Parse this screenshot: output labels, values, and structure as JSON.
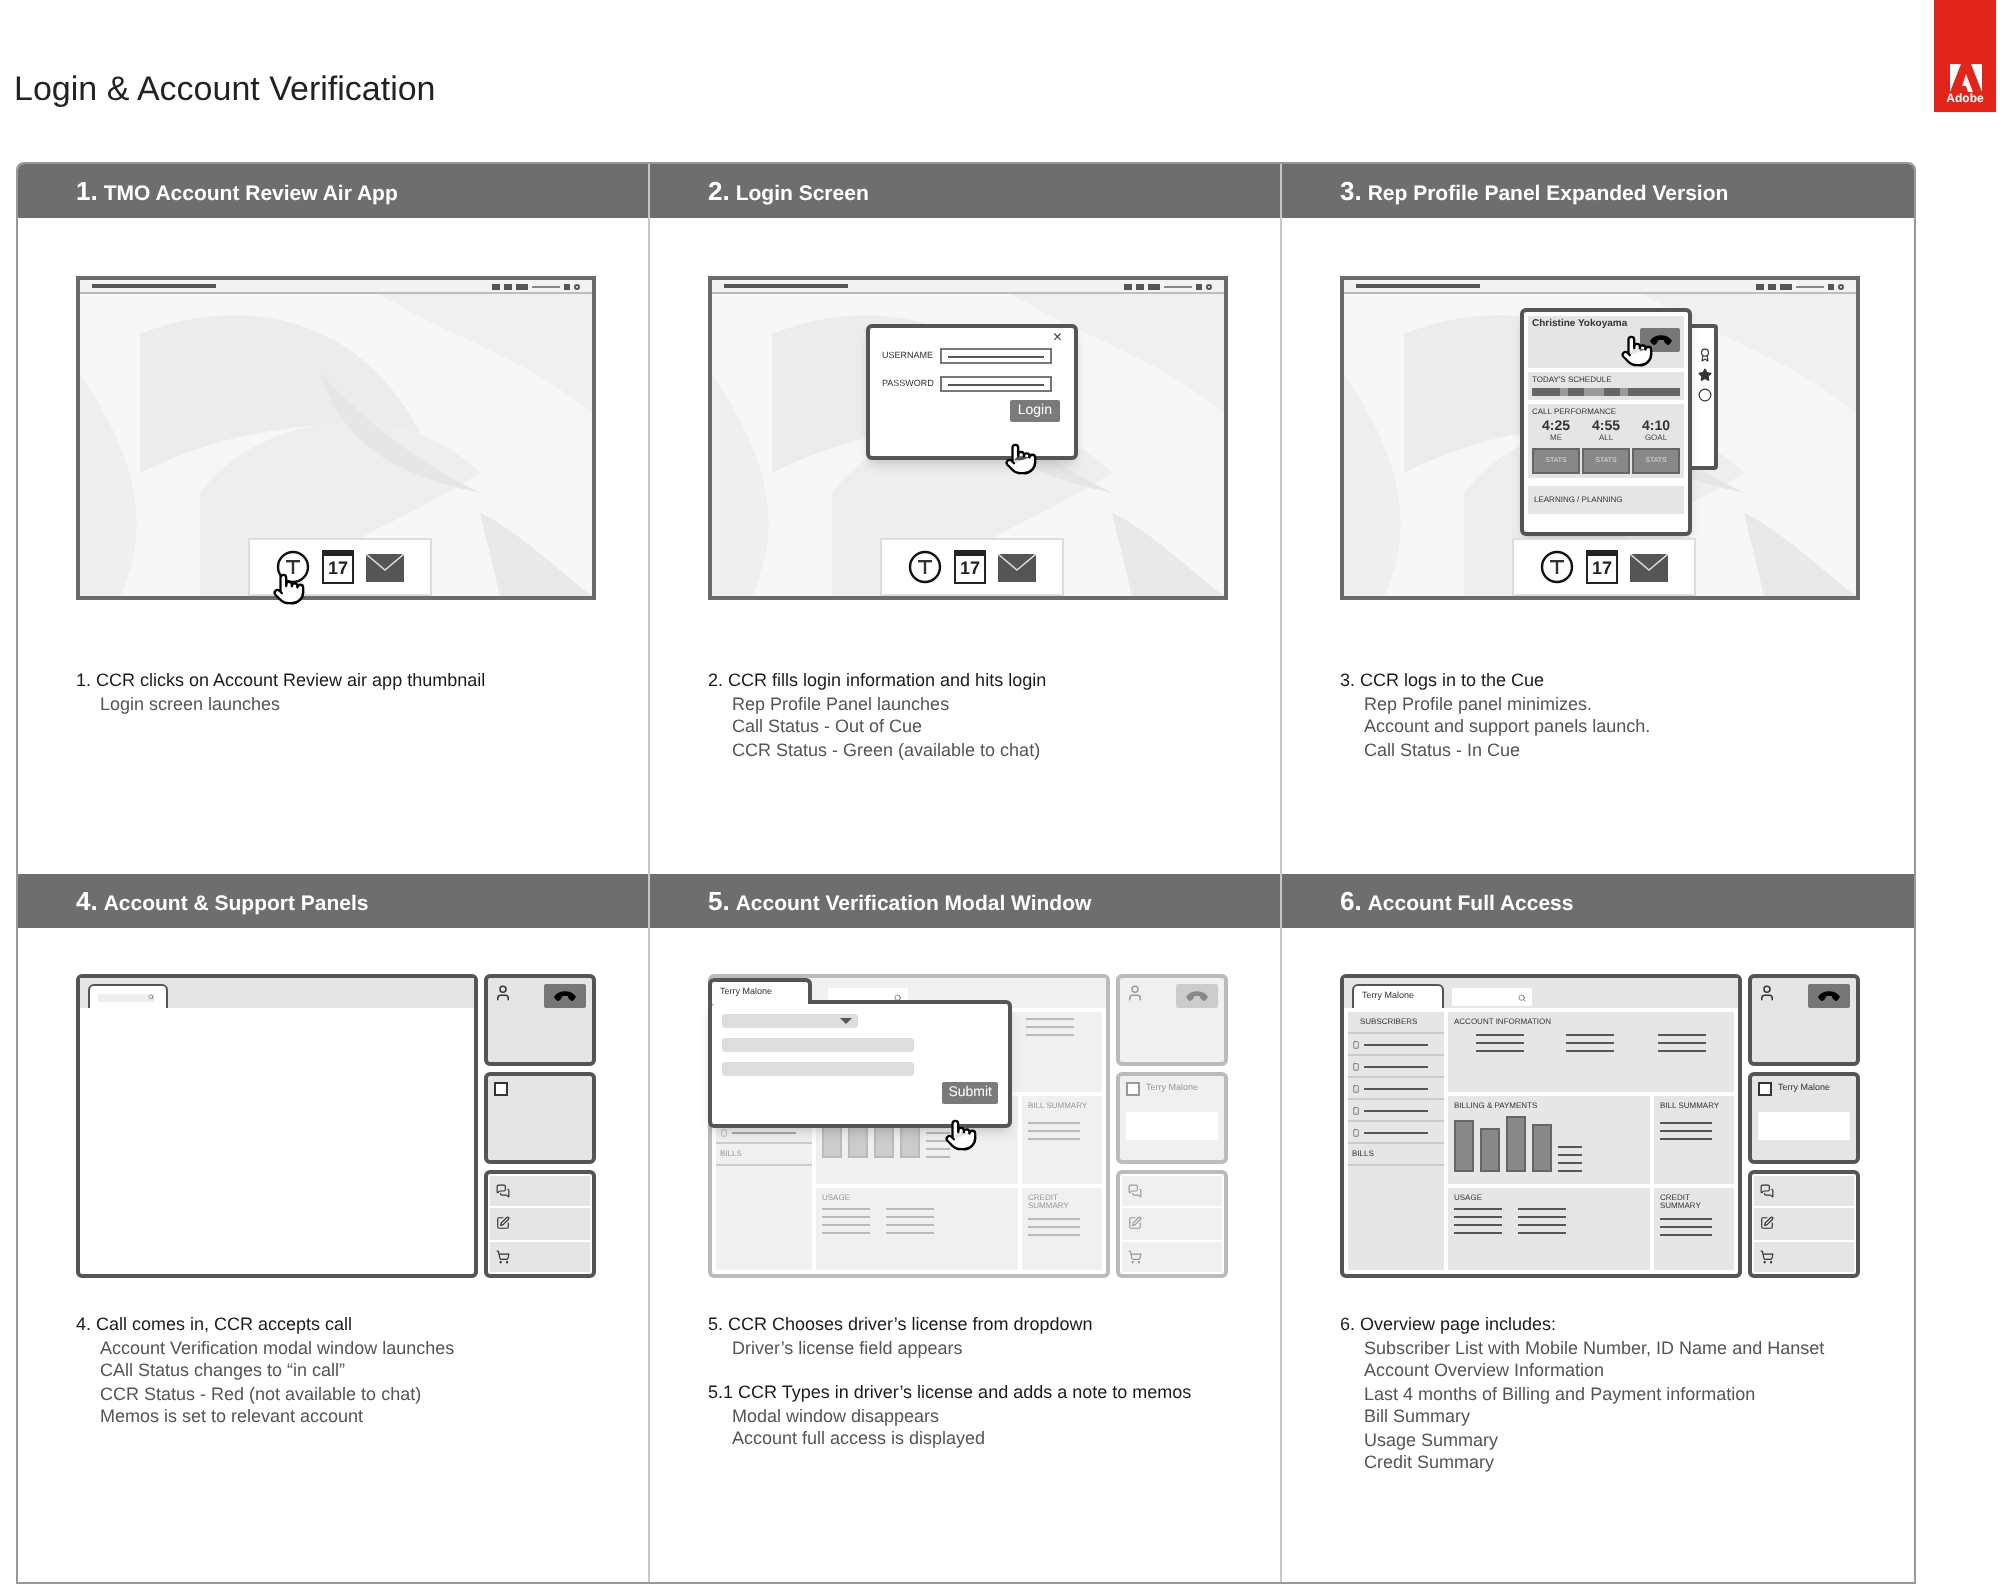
{
  "page_title": "Login & Account Verification",
  "logo": {
    "label": "Adobe"
  },
  "steps": [
    {
      "number": "1.",
      "title": "TMO Account Review Air App",
      "mockup": {
        "kind": "desktop",
        "cursor": true,
        "calendar_day": "17"
      },
      "notes": [
        {
          "heading": "1. CCR clicks on Account Review air app thumbnail",
          "lines": [
            "Login screen launches"
          ]
        }
      ]
    },
    {
      "number": "2.",
      "title": "Login Screen",
      "mockup": {
        "kind": "login",
        "cursor": true,
        "calendar_day": "17",
        "close": "×",
        "username_label": "USERNAME",
        "password_label": "PASSWORD",
        "button": "Login"
      },
      "notes": [
        {
          "heading": "2. CCR fills login information and hits login",
          "lines": [
            "Rep Profile Panel launches",
            "Call Status - Out of Cue",
            "CCR Status - Green (available to chat)"
          ]
        }
      ]
    },
    {
      "number": "3.",
      "title": "Rep Profile Panel Expanded Version",
      "mockup": {
        "kind": "profile",
        "cursor": true,
        "calendar_day": "17",
        "name": "Christine Yokoyama",
        "schedule_label": "TODAY'S SCHEDULE",
        "performance_label": "CALL PERFORMANCE",
        "metrics": [
          {
            "value": "4:25",
            "label": "ME"
          },
          {
            "value": "4:55",
            "label": "ALL"
          },
          {
            "value": "4:10",
            "label": "GOAL"
          }
        ],
        "stats": [
          "STATS",
          "STATS",
          "STATS"
        ],
        "footer": "LEARNING / PLANNING"
      },
      "notes": [
        {
          "heading": "3. CCR logs in to the Cue",
          "lines": [
            "Rep Profile panel minimizes.",
            "Account  and support panels launch.",
            "Call Status - In Cue"
          ]
        }
      ]
    },
    {
      "number": "4.",
      "title": "Account & Support Panels",
      "mockup": {
        "kind": "panels",
        "cursor": false,
        "checked": false
      },
      "notes": [
        {
          "heading": "4. Call comes in, CCR accepts call",
          "lines": [
            "Account Verification modal window launches",
            "CAll Status changes to “in call”",
            "CCR Status - Red (not available to chat)",
            "Memos is set to relevant account"
          ]
        }
      ]
    },
    {
      "number": "5.",
      "title": "Account Verification Modal Window",
      "mockup": {
        "kind": "verification",
        "cursor": true,
        "tab": "Terry Malone",
        "button": "Submit",
        "sidebar_footer": "BILLS",
        "bill_summary": "BILL SUMMARY",
        "usage": "USAGE",
        "credit_summary": "CREDIT SUMMARY",
        "contact": "Terry Malone",
        "checked": false
      },
      "notes": [
        {
          "heading": "5. CCR Chooses driver’s license from dropdown",
          "lines": [
            "Driver’s license field appears"
          ]
        },
        {
          "heading": "5.1 CCR Types in driver’s license and adds a note to memos",
          "lines": [
            "Modal window disappears",
            "Account full access is displayed"
          ]
        }
      ]
    },
    {
      "number": "6.",
      "title": "Account Full Access",
      "mockup": {
        "kind": "full",
        "cursor": false,
        "tab": "Terry Malone",
        "sidebar_header": "SUBSCRIBERS",
        "sidebar_footer": "BILLS",
        "account_info": "ACCOUNT INFORMATION",
        "billing": "BILLING & PAYMENTS",
        "bill_summary": "BILL SUMMARY",
        "usage": "USAGE",
        "credit_summary": "CREDIT SUMMARY",
        "contact": "Terry Malone",
        "checked": false
      },
      "notes": [
        {
          "heading": "6. Overview page includes:",
          "lines": [
            "Subscriber List with Mobile Number, ID Name and Hanset",
            "Account Overview Information",
            "Last 4 months of Billing and Payment information",
            "Bill Summary",
            "Usage Summary",
            "Credit Summary"
          ]
        }
      ]
    }
  ]
}
